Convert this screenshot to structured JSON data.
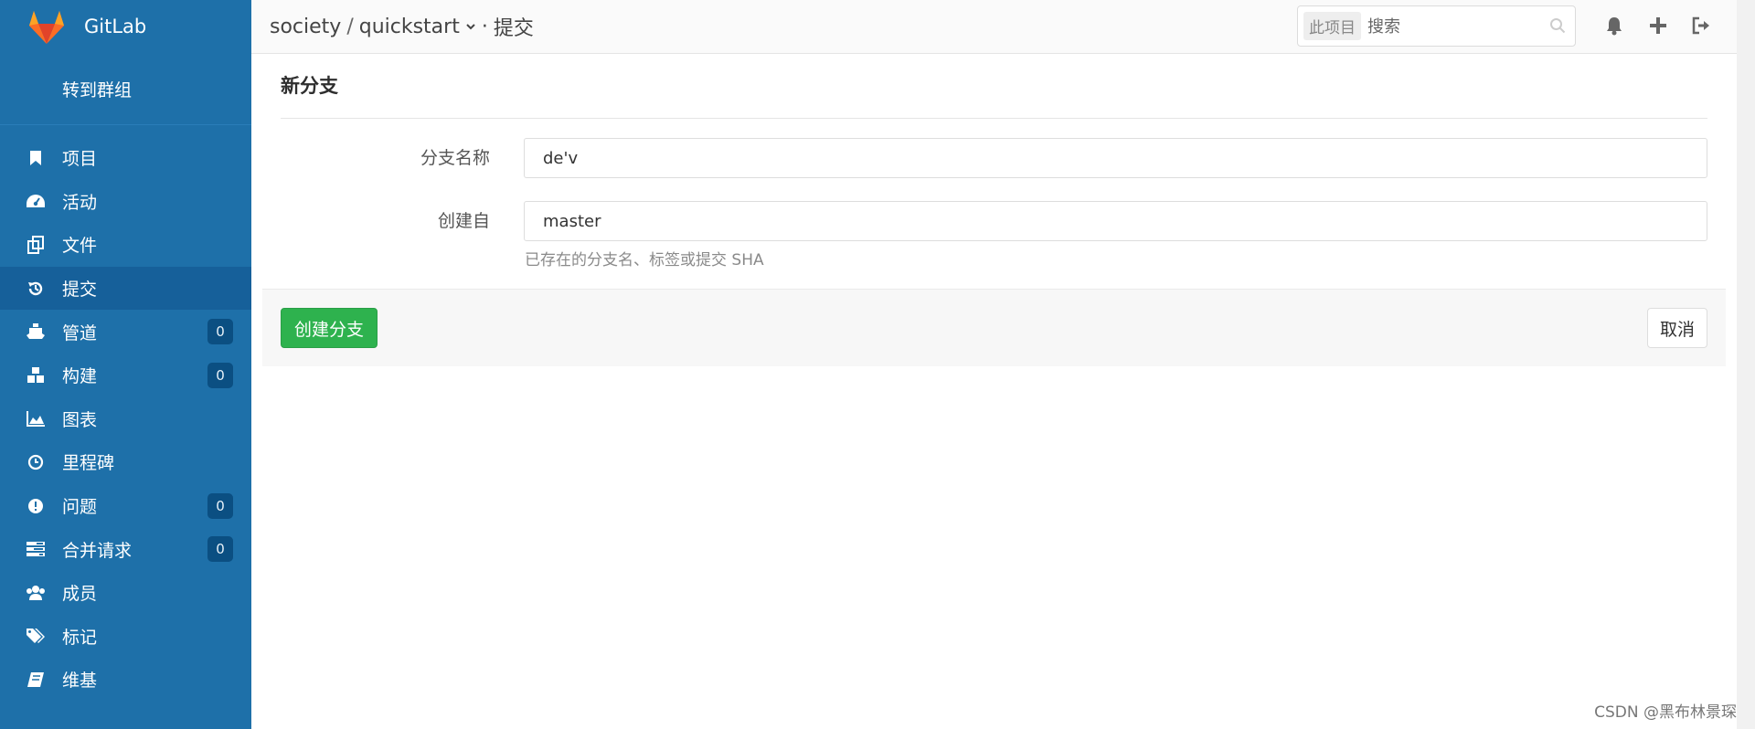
{
  "app": {
    "name": "GitLab"
  },
  "sidebar": {
    "group_link": "转到群组",
    "items": [
      {
        "label": "项目",
        "icon": "bookmark-icon"
      },
      {
        "label": "活动",
        "icon": "dashboard-icon"
      },
      {
        "label": "文件",
        "icon": "files-icon"
      },
      {
        "label": "提交",
        "icon": "history-icon",
        "active": true
      },
      {
        "label": "管道",
        "icon": "ship-icon",
        "badge": "0"
      },
      {
        "label": "构建",
        "icon": "cubes-icon",
        "badge": "0"
      },
      {
        "label": "图表",
        "icon": "area-chart-icon"
      },
      {
        "label": "里程碑",
        "icon": "clock-icon"
      },
      {
        "label": "问题",
        "icon": "exclamation-circle-icon",
        "badge": "0"
      },
      {
        "label": "合并请求",
        "icon": "tasks-icon",
        "badge": "0"
      },
      {
        "label": "成员",
        "icon": "users-icon"
      },
      {
        "label": "标记",
        "icon": "tags-icon"
      },
      {
        "label": "维基",
        "icon": "book-icon"
      }
    ]
  },
  "header": {
    "breadcrumb": {
      "group": "society",
      "separator": "/",
      "project": "quickstart",
      "dot": "·",
      "page": "提交"
    },
    "search": {
      "scope": "此项目",
      "placeholder": "搜索"
    }
  },
  "form": {
    "title": "新分支",
    "branch_name_label": "分支名称",
    "branch_name_value": "de'v",
    "create_from_label": "创建自",
    "create_from_value": "master",
    "help_text": "已存在的分支名、标签或提交 SHA",
    "create_button": "创建分支",
    "cancel_button": "取消"
  },
  "watermark": "CSDN @黑布林景琛",
  "colors": {
    "sidebar": "#1e70a9",
    "sidebar_active": "#16609a",
    "badge": "#0b4f82",
    "create_button": "#2eb24e"
  }
}
